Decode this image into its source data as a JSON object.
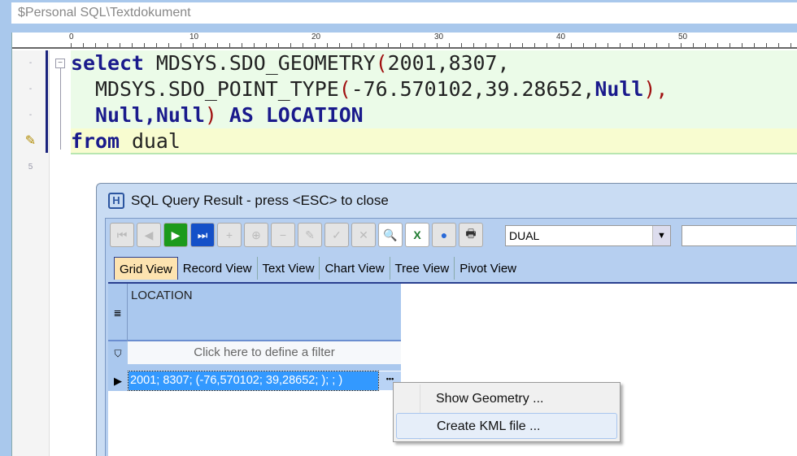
{
  "path": "$Personal SQL\\Textdokument",
  "ruler": [
    "0",
    "10",
    "20",
    "30",
    "40",
    "50"
  ],
  "gutter": [
    "-",
    "-",
    "-",
    "",
    "5"
  ],
  "code": {
    "l1a": "select",
    "l1b": " MDSYS.SDO_GEOMETRY",
    "l1c": "(",
    "l1d": "2001,8307,",
    "l2a": "  MDSYS.SDO_POINT_TYPE",
    "l2b": "(",
    "l2c": "-76.570102,39.28652,",
    "l2d": "Null",
    "l2e": ")",
    "l2f": ",",
    "l3a": "  Null,Null",
    "l3b": ")",
    "l3c": " AS LOCATION",
    "l4a": "from",
    "l4b": " dual"
  },
  "dialog": {
    "title": "SQL Query Result  -  press <ESC> to close",
    "icon_label": "H",
    "table_select": "DUAL",
    "tabs": [
      "Grid View",
      "Record View",
      "Text View",
      "Chart View",
      "Tree View",
      "Pivot View"
    ],
    "column": "LOCATION",
    "filter": "Click here to define a filter",
    "cell": "2001; 8307; (-76,570102; 39,28652; ); ; )",
    "ellipsis": "•••"
  },
  "menu": [
    "Show Geometry ...",
    "Create KML file ..."
  ]
}
